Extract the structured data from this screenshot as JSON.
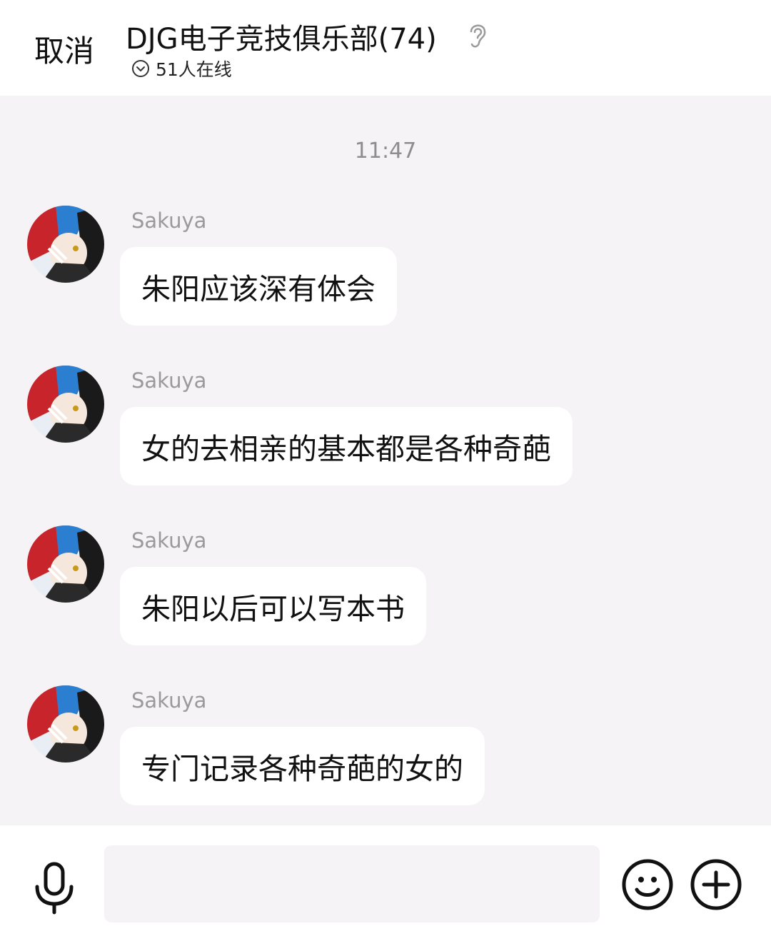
{
  "header": {
    "cancel_label": "取消",
    "title": "DJG电子竞技俱乐部(74)",
    "online_status": "51人在线",
    "ear_icon": "ear-icon"
  },
  "chat": {
    "timestamp": "11:47",
    "messages": [
      {
        "sender": "Sakuya",
        "text": "朱阳应该深有体会"
      },
      {
        "sender": "Sakuya",
        "text": "女的去相亲的基本都是各种奇葩"
      },
      {
        "sender": "Sakuya",
        "text": "朱阳以后可以写本书"
      },
      {
        "sender": "Sakuya",
        "text": "专门记录各种奇葩的女的"
      }
    ]
  },
  "input": {
    "value": "",
    "placeholder": "",
    "mic_icon": "microphone-icon",
    "emoji_icon": "smiley-icon",
    "plus_icon": "plus-circle-icon"
  },
  "colors": {
    "background": "#f5f3f5",
    "bubble": "#ffffff",
    "sender_name": "#9a9a9a",
    "text": "#111111"
  }
}
